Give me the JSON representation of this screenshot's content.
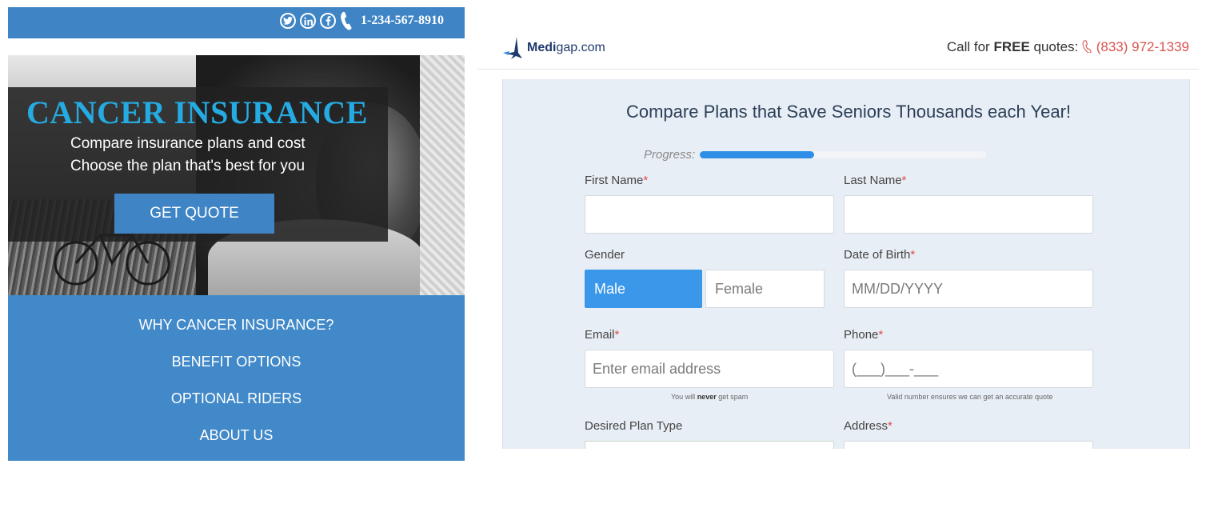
{
  "left": {
    "phone": "1-234-567-8910",
    "hero_title": "CANCER INSURANCE",
    "hero_line1": "Compare insurance plans and cost",
    "hero_line2": "Choose the plan that's best for you",
    "cta_label": "GET QUOTE",
    "nav": [
      "WHY CANCER INSURANCE?",
      "BENEFIT OPTIONS",
      "OPTIONAL RIDERS",
      "ABOUT US"
    ],
    "social_icons": [
      "twitter-icon",
      "linkedin-icon",
      "facebook-icon",
      "phone-icon"
    ],
    "colors": {
      "bar": "#3f85c6",
      "title": "#25aae1",
      "nav": "#4189c9"
    }
  },
  "right": {
    "logo": {
      "bold": "Medi",
      "rest": "gap.com"
    },
    "call_prefix": "Call for ",
    "call_bold": "FREE",
    "call_suffix": " quotes: ",
    "call_number": "(833) 972-1339",
    "form_title": "Compare Plans that Save Seniors Thousands each Year!",
    "progress_label": "Progress:",
    "progress_fraction": 0.4,
    "fields": {
      "first_name": "First Name",
      "last_name": "Last Name",
      "gender": "Gender",
      "gender_male": "Male",
      "gender_female": "Female",
      "dob": "Date of Birth",
      "dob_placeholder": "MM/DD/YYYY",
      "email": "Email",
      "email_placeholder": "Enter email address",
      "phone": "Phone",
      "phone_placeholder": "(___)___-___",
      "plan_type": "Desired Plan Type",
      "address": "Address",
      "required_mark": "*"
    },
    "email_hint_pre": "You will ",
    "email_hint_bold": "never",
    "email_hint_post": " get spam",
    "phone_hint": "Valid number ensures we can get an accurate quote",
    "colors": {
      "accent": "#2f8fe6",
      "phone_red": "#d9534f",
      "form_bg": "#e8eef5"
    }
  }
}
